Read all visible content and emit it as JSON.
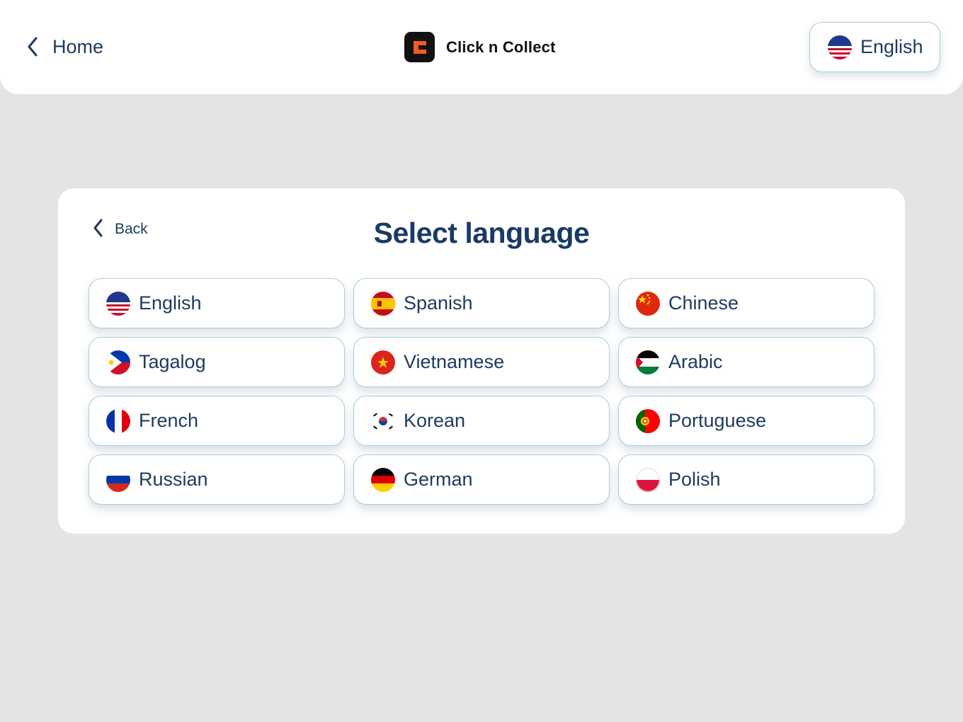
{
  "header": {
    "home_label": "Home",
    "brand_name": "Click n Collect",
    "current_language": "English",
    "current_language_flag": "us-flag-icon"
  },
  "card": {
    "back_label": "Back",
    "title": "Select language"
  },
  "languages": [
    {
      "label": "English",
      "flag": "us-flag-icon"
    },
    {
      "label": "Spanish",
      "flag": "spain-flag-icon"
    },
    {
      "label": "Chinese",
      "flag": "china-flag-icon"
    },
    {
      "label": "Tagalog",
      "flag": "philippines-flag-icon"
    },
    {
      "label": "Vietnamese",
      "flag": "vietnam-flag-icon"
    },
    {
      "label": "Arabic",
      "flag": "arabic-flag-icon"
    },
    {
      "label": "French",
      "flag": "france-flag-icon"
    },
    {
      "label": "Korean",
      "flag": "korea-flag-icon"
    },
    {
      "label": "Portuguese",
      "flag": "portugal-flag-icon"
    },
    {
      "label": "Russian",
      "flag": "russia-flag-icon"
    },
    {
      "label": "German",
      "flag": "germany-flag-icon"
    },
    {
      "label": "Polish",
      "flag": "poland-flag-icon"
    }
  ],
  "colors": {
    "background": "#e4e4e4",
    "text": "#1e3a5f",
    "title": "#1a3a66",
    "button_border": "#a9cde0",
    "brand_orange": "#f25c1f"
  }
}
